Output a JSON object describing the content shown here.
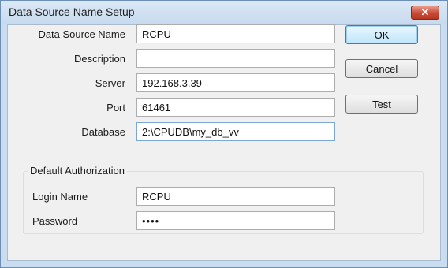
{
  "window": {
    "title": "Data Source Name Setup",
    "close_icon": "✕"
  },
  "form": {
    "dsn_label": "Data Source Name",
    "dsn_value": "RCPU",
    "description_label": "Description",
    "description_value": "",
    "server_label": "Server",
    "server_value": "192.168.3.39",
    "port_label": "Port",
    "port_value": "61461",
    "database_label": "Database",
    "database_value": "2:\\CPUDB\\my_db_vv"
  },
  "buttons": {
    "ok": "OK",
    "cancel": "Cancel",
    "test": "Test"
  },
  "auth": {
    "group_title": "Default Authorization",
    "login_label": "Login Name",
    "login_value": "RCPU",
    "password_label": "Password",
    "password_value": "••••"
  }
}
